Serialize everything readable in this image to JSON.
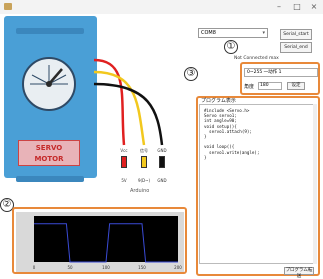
{
  "window": {
    "controls": {
      "minimize": "–",
      "maximize": "□",
      "close": "×"
    }
  },
  "servo": {
    "motor_label_line1": "SERVO",
    "motor_label_line2": "MOTOR",
    "board_label": "Arduino",
    "wire_labels": [
      "Vcc",
      "信号",
      "GND"
    ],
    "pin_labels": [
      "5V",
      "9(D~)",
      "GND"
    ],
    "wire_colors": [
      "#e02020",
      "#f2c81e",
      "#111111"
    ]
  },
  "serial": {
    "port_value": "COM8",
    "port_options": [],
    "open_button": "Serial_start",
    "close_button": "Serial_end",
    "status": "Not Connected max"
  },
  "controls": {
    "mode_value": "0~255 一动作 1",
    "angle_label": "角度",
    "angle_value": "180",
    "apply_button": "设定"
  },
  "code": {
    "title": "プログラム表示",
    "lines": [
      "#include <Servo.h>",
      "Servo servo1;",
      "int angle=90;",
      "void setup(){",
      "  servo1.attach(9);",
      "}",
      "",
      "void loop(){",
      "  servo1.write(angle);",
      "}"
    ],
    "copy_button": "プログラム転送"
  },
  "callouts": [
    "①",
    "②",
    "③"
  ],
  "chart_data": {
    "type": "line",
    "title": "",
    "x": [
      0,
      45,
      50,
      100,
      105,
      150,
      155,
      200
    ],
    "y": [
      1,
      1,
      0,
      0,
      1,
      1,
      0,
      0
    ],
    "x_ticks": [
      "0",
      "50",
      "100",
      "150",
      "200"
    ],
    "xlim": [
      0,
      200
    ],
    "ylim": [
      0,
      1.2
    ],
    "series_color": "#3a4bd6",
    "background": "#000000",
    "grid": false
  }
}
